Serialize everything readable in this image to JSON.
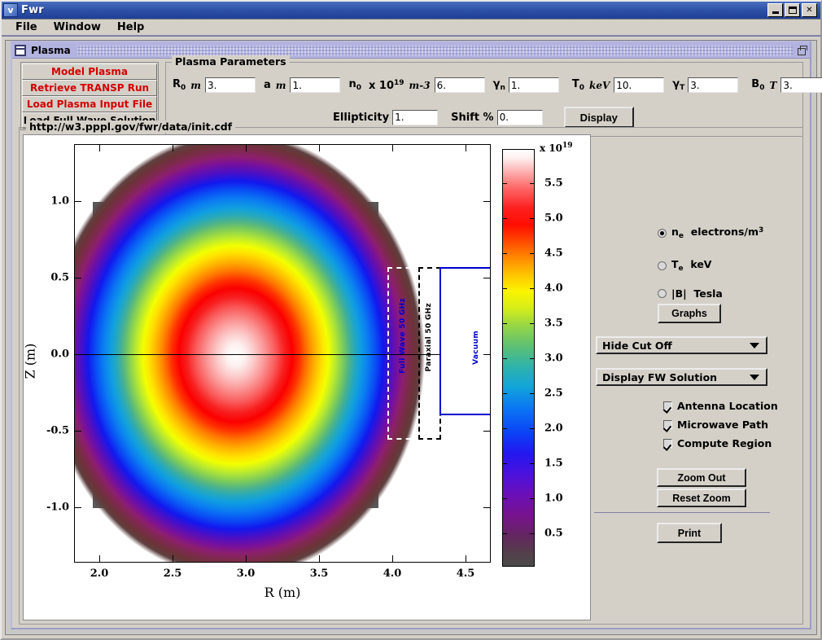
{
  "window": {
    "title": "Fwr",
    "sys_icon": "window-menu-icon",
    "buttons": {
      "minimize": "minimize-icon",
      "maximize": "maximize-icon",
      "close": "close-icon"
    }
  },
  "menubar": {
    "items": [
      "File",
      "Window",
      "Help"
    ]
  },
  "internal_frame": {
    "title": "Plasma",
    "icon": "frame-icon",
    "restore": "restore-icon"
  },
  "left_buttons": [
    {
      "label": "Model Plasma",
      "color": "#d40000"
    },
    {
      "label": "Retrieve TRANSP Run",
      "color": "#d40000"
    },
    {
      "label": "Load Plasma Input File",
      "color": "#d40000"
    },
    {
      "label": "Load Full Wave Solution",
      "color": "#000000"
    }
  ],
  "plasma_parameters": {
    "legend": "Plasma Parameters",
    "fields": [
      {
        "name": "R0",
        "symbol": "R",
        "subscript": "0",
        "unit": "m",
        "value": "3."
      },
      {
        "name": "a",
        "symbol": "a",
        "subscript": "",
        "unit": "m",
        "value": "1."
      },
      {
        "name": "n0",
        "symbol": "n",
        "subscript": "0",
        "unit": "x 10^19 m^-3",
        "value": "6."
      },
      {
        "name": "gamma_n",
        "symbol": "γ",
        "subscript": "n",
        "unit": "",
        "value": "1."
      },
      {
        "name": "T0",
        "symbol": "T",
        "subscript": "0",
        "unit": "keV",
        "value": "10."
      },
      {
        "name": "gamma_T",
        "symbol": "γ",
        "subscript": "T",
        "unit": "",
        "value": "3."
      },
      {
        "name": "B0",
        "symbol": "B",
        "subscript": "0",
        "unit": "T",
        "value": "3."
      }
    ],
    "ellipticity_label": "Ellipticity",
    "ellipticity_value": "1.",
    "shift_label": "Shift %",
    "shift_value": "0.",
    "display_button": "Display"
  },
  "url_legend": "http://w3.pppl.gov/fwr/data/init.cdf",
  "controls": {
    "radios": [
      {
        "label_html": "n_e  electrons/m^3",
        "base": "n",
        "sub": "e",
        "rest": "electrons/m",
        "sup": "3",
        "selected": true
      },
      {
        "label_html": "T_e  keV",
        "base": "T",
        "sub": "e",
        "rest": "keV",
        "sup": "",
        "selected": false
      },
      {
        "label_html": "|B|  Tesla",
        "base": "|B|",
        "sub": "",
        "rest": "Tesla",
        "sup": "",
        "selected": false
      }
    ],
    "graphs_button": "Graphs",
    "cutoff_combo": "Hide Cut Off",
    "solution_combo": "Display FW Solution",
    "checkboxes": [
      {
        "label": "Antenna Location",
        "checked": true
      },
      {
        "label": "Microwave Path",
        "checked": true
      },
      {
        "label": "Compute Region",
        "checked": true
      }
    ],
    "zoom_out_button": "Zoom Out",
    "reset_zoom_button": "Reset Zoom",
    "print_button": "Print"
  },
  "chart_data": {
    "type": "heatmap",
    "title": "",
    "xlabel": "R (m)",
    "ylabel": "Z (m)",
    "xlim": [
      1.85,
      4.72
    ],
    "ylim": [
      -1.27,
      1.37
    ],
    "xticks": [
      "2.0",
      "2.5",
      "3.0",
      "3.5",
      "4.0",
      "4.5"
    ],
    "xtick_values": [
      2.0,
      2.5,
      3.0,
      3.5,
      4.0,
      4.5
    ],
    "yticks": [
      "1.0",
      "0.5",
      "0.0",
      "-0.5",
      "-1.0"
    ],
    "ytick_values": [
      1.0,
      0.5,
      0.0,
      -0.5,
      -1.0
    ],
    "grid": false,
    "colorbar": {
      "exponent_label": "x 10",
      "exponent_sup": "19",
      "ticks": [
        "5.5",
        "5.0",
        "4.5",
        "4.0",
        "3.5",
        "3.0",
        "2.5",
        "2.0",
        "1.5",
        "1.0",
        "0.5"
      ],
      "tick_values": [
        5.5,
        5.0,
        4.5,
        4.0,
        3.5,
        3.0,
        2.5,
        2.0,
        1.5,
        1.0,
        0.5
      ],
      "range": [
        0.0,
        6.0
      ],
      "units": "electrons/m^3",
      "colormap": "nipy-spectral"
    },
    "field": {
      "quantity": "electron density",
      "peak_value": 6.0,
      "peak_center_R": 3.0,
      "peak_center_Z": 0.0,
      "minor_radius_a": 1.0,
      "background_value": 0.0,
      "background_color": "#595959"
    },
    "annotations": [
      {
        "name": "full-wave-region",
        "text": "Full Wave 50 GHz",
        "color": "#0000cc",
        "style": "dashed-white-box"
      },
      {
        "name": "paraxial-region",
        "text": "Paraxial 50 GHz",
        "color": "#000000",
        "style": "dashed-black-box"
      },
      {
        "name": "vacuum-region",
        "text": "Vacuum",
        "color": "#0000cc",
        "style": "solid-blue-box"
      }
    ],
    "domain_rect": {
      "R_min": 2.0,
      "R_max": 3.95,
      "Z_min": -1.0,
      "Z_max": 1.0
    }
  }
}
